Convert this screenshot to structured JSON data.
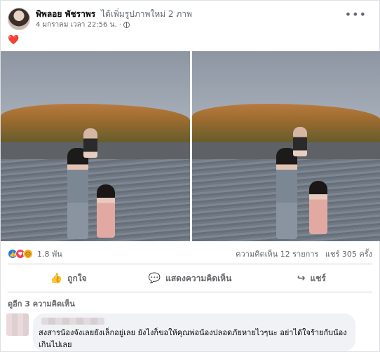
{
  "post": {
    "author_name": "พิพลอย พัชราพร",
    "action_text": "ได้เพิ่มรูปภาพใหม่ 2 ภาพ",
    "timestamp": "4 มกราคม เวลา 22:56 น. ·",
    "privacy_icon": "globe-icon",
    "more_icon": "•••",
    "caption_emoji": "❤️"
  },
  "photos": [
    {
      "name": "photo-1"
    },
    {
      "name": "photo-2"
    }
  ],
  "stats": {
    "reaction_icons": [
      "like-icon",
      "love-icon",
      "sad-icon"
    ],
    "reaction_count": "1.8 พัน",
    "comments": "ความคิดเห็น 12 รายการ",
    "shares": "แชร์ 305 ครั้ง"
  },
  "actions": {
    "like": "ถูกใจ",
    "comment": "แสดงความคิดเห็น",
    "share": "แชร์"
  },
  "comments": {
    "view_more": "ดูอีก 3 ความคิดเห็น",
    "items": [
      {
        "text": "สงสารน้องจังเลยยังเล็กอยู่เลย ยังไงก็ขอให้คุณพ่อน้องปลอดภัยหายไวๆนะ อย่าได้ใจร้ายกับน้องเกินไปเลย"
      }
    ]
  },
  "colors": {
    "like_blue": "#1877f2",
    "love_red": "#f33e58",
    "sad_yellow": "#f7b125",
    "secondary_text": "#65676b"
  }
}
